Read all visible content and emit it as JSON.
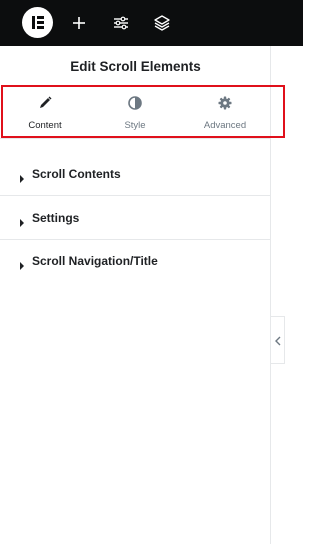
{
  "topbar": {
    "logo": "elementor-logo",
    "icons": [
      "add-icon",
      "settings-sliders-icon",
      "layers-icon"
    ]
  },
  "panel": {
    "title": "Edit Scroll Elements",
    "tabs": [
      {
        "label": "Content",
        "icon": "pencil-icon",
        "active": true
      },
      {
        "label": "Style",
        "icon": "half-circle-icon",
        "active": false
      },
      {
        "label": "Advanced",
        "icon": "gear-icon",
        "active": false
      }
    ],
    "sections": [
      {
        "label": "Scroll Contents"
      },
      {
        "label": "Settings"
      },
      {
        "label": "Scroll Navigation/Title"
      }
    ]
  },
  "colors": {
    "topbar_bg": "#0c0d0e",
    "highlight": "#e0101b",
    "text_dark": "#1f2124",
    "text_muted": "#6d7882"
  }
}
